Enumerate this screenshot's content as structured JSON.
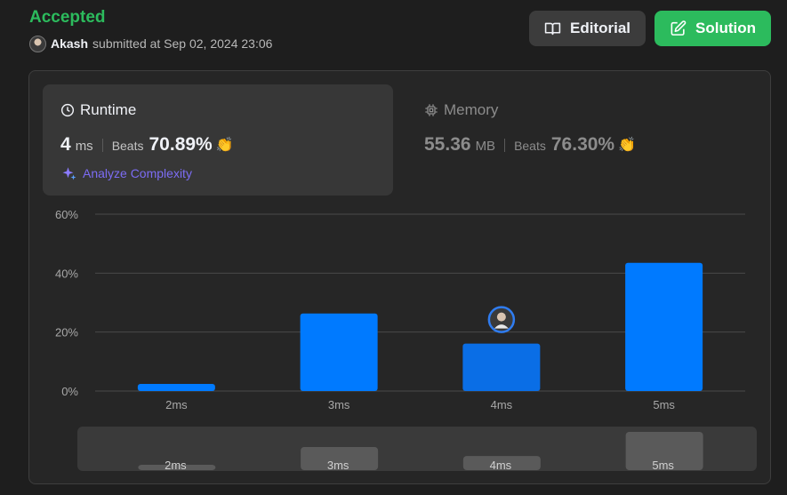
{
  "status": "Accepted",
  "submitter": {
    "name": "Akash",
    "text": "submitted at Sep 02, 2024 23:06"
  },
  "buttons": {
    "editorial": "Editorial",
    "solution": "Solution"
  },
  "runtime": {
    "title": "Runtime",
    "value": "4",
    "unit": "ms",
    "beats_label": "Beats",
    "beats": "70.89%",
    "analyze": "Analyze Complexity"
  },
  "memory": {
    "title": "Memory",
    "value": "55.36",
    "unit": "MB",
    "beats_label": "Beats",
    "beats": "76.30%"
  },
  "colors": {
    "accent": "#2cbb5d",
    "bar": "#007aff",
    "bar_selected": "#0a6ee6",
    "analyze": "#7c6cf4"
  },
  "icons": [
    "avatar",
    "book-icon",
    "edit-icon",
    "clock-icon",
    "chip-icon",
    "sparkle-icon",
    "clap-icon"
  ],
  "chart_data": {
    "type": "bar",
    "categories": [
      "2ms",
      "3ms",
      "4ms",
      "5ms"
    ],
    "values": [
      2.4,
      26.3,
      16.1,
      43.5
    ],
    "yticks": [
      "0%",
      "20%",
      "40%",
      "60%"
    ],
    "ylim": [
      0,
      60
    ],
    "selected": "4ms",
    "grid": true
  }
}
